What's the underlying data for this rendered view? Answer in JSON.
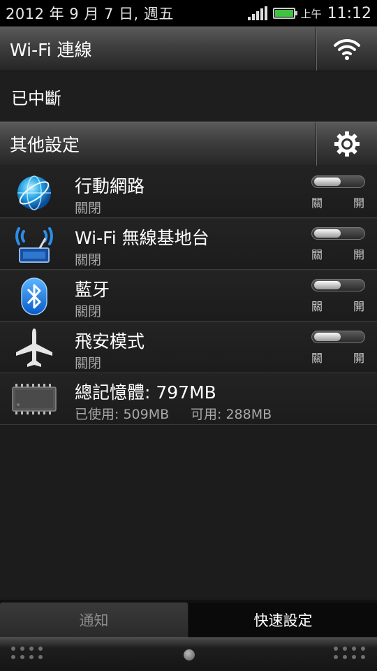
{
  "status_bar": {
    "date": "2012 年 9 月 7 日, 週五",
    "ampm": "上午",
    "time": "11:12",
    "battery_level": 1.0,
    "battery_color": "#3ec43e"
  },
  "wifi_section": {
    "title": "Wi-Fi 連線",
    "icon": "wifi-icon",
    "status": "已中斷"
  },
  "other_section": {
    "title": "其他設定",
    "icon": "gear-icon"
  },
  "settings": [
    {
      "title": "行動網路",
      "state": "關閉",
      "toggle_off": "關",
      "toggle_on": "開",
      "icon": "globe-icon",
      "enabled": false
    },
    {
      "title": "Wi-Fi 無線基地台",
      "state": "關閉",
      "toggle_off": "關",
      "toggle_on": "開",
      "icon": "hotspot-icon",
      "enabled": false
    },
    {
      "title": "藍牙",
      "state": "關閉",
      "toggle_off": "關",
      "toggle_on": "開",
      "icon": "bluetooth-icon",
      "enabled": false
    },
    {
      "title": "飛安模式",
      "state": "關閉",
      "toggle_off": "關",
      "toggle_on": "開",
      "icon": "airplane-icon",
      "enabled": false
    }
  ],
  "memory": {
    "title": "總記憶體: 797MB",
    "used": "已使用: 509MB",
    "free": "可用: 288MB",
    "icon": "memory-chip-icon"
  },
  "tabs": [
    {
      "label": "通知",
      "active": false
    },
    {
      "label": "快速設定",
      "active": true
    }
  ]
}
